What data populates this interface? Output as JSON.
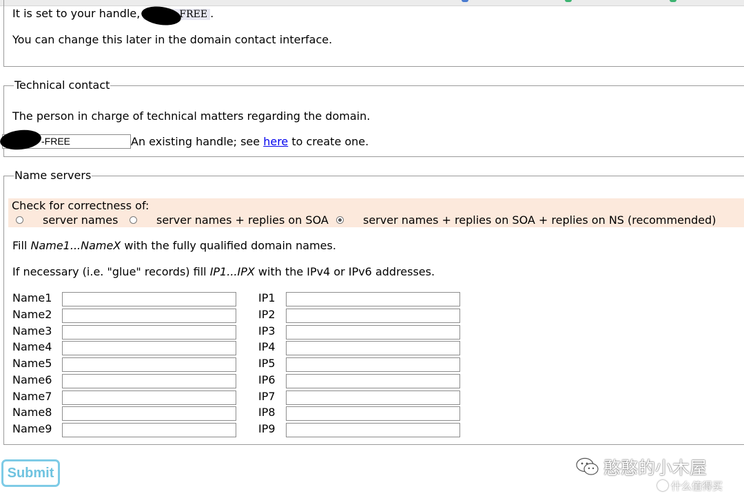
{
  "owner_section": {
    "handle_prefix": "It is set to your handle, ",
    "handle_value": "FREE",
    "handle_suffix": ".",
    "note": "You can change this later in the domain contact interface."
  },
  "technical_contact": {
    "legend": "Technical contact",
    "description": "The person in charge of technical matters regarding the domain.",
    "handle_input_value": "-FREE",
    "helper_prefix": "An existing handle; see ",
    "helper_link": "here",
    "helper_suffix": " to create one."
  },
  "name_servers": {
    "legend": "Name servers",
    "check_label": "Check for correctness of:",
    "options": [
      {
        "label": "server names",
        "checked": false
      },
      {
        "label": "server names + replies on SOA",
        "checked": false
      },
      {
        "label": "server names + replies on SOA + replies on NS (recommended)",
        "checked": true
      }
    ],
    "fill_names": {
      "prefix": "Fill ",
      "emph": "Name1...NameX",
      "suffix": " with the fully qualified domain names."
    },
    "fill_ips": {
      "prefix": "If necessary (i.e. \"glue\" records) fill ",
      "emph": "IP1...IPX",
      "suffix": " with the IPv4 or IPv6 addresses."
    },
    "rows": [
      {
        "name_label": "Name1",
        "ip_label": "IP1",
        "name_value": "",
        "ip_value": ""
      },
      {
        "name_label": "Name2",
        "ip_label": "IP2",
        "name_value": "",
        "ip_value": ""
      },
      {
        "name_label": "Name3",
        "ip_label": "IP3",
        "name_value": "",
        "ip_value": ""
      },
      {
        "name_label": "Name4",
        "ip_label": "IP4",
        "name_value": "",
        "ip_value": ""
      },
      {
        "name_label": "Name5",
        "ip_label": "IP5",
        "name_value": "",
        "ip_value": ""
      },
      {
        "name_label": "Name6",
        "ip_label": "IP6",
        "name_value": "",
        "ip_value": ""
      },
      {
        "name_label": "Name7",
        "ip_label": "IP7",
        "name_value": "",
        "ip_value": ""
      },
      {
        "name_label": "Name8",
        "ip_label": "IP8",
        "name_value": "",
        "ip_value": ""
      },
      {
        "name_label": "Name9",
        "ip_label": "IP9",
        "name_value": "",
        "ip_value": ""
      }
    ]
  },
  "submit_label": "Submit",
  "watermark": {
    "main": "憨憨的小木屋",
    "sub": "什么值得买",
    "icon": "wechat-icon"
  },
  "colors": {
    "panel_bg": "#fce9dc",
    "link": "#0000ee",
    "submit": "#6fc3e0"
  }
}
